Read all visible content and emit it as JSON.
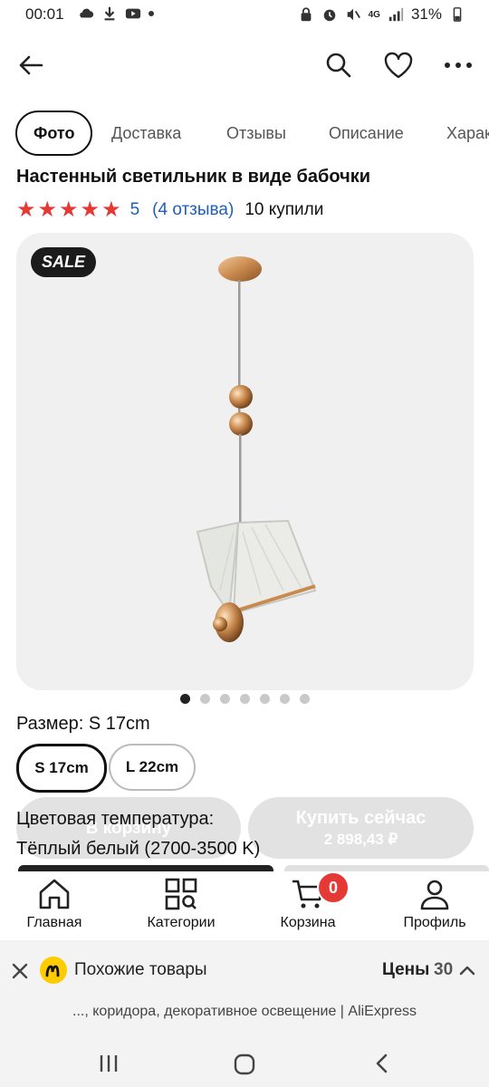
{
  "status": {
    "time": "00:01",
    "battery": "31%",
    "network": "4G"
  },
  "header": {
    "back_icon": "back-arrow-icon",
    "search_icon": "search-icon",
    "favorite_icon": "heart-icon",
    "more_icon": "more-dots-icon"
  },
  "tabs": [
    {
      "label": "Фото"
    },
    {
      "label": "Доставка"
    },
    {
      "label": "Отзывы"
    },
    {
      "label": "Описание"
    },
    {
      "label": "Харак"
    }
  ],
  "product": {
    "title": "Настенный светильник в виде бабочки",
    "rating": 5,
    "rating_text": "5",
    "reviews_text": "(4 отзыва)",
    "bought_text": "10 купили",
    "sale_badge": "SALE",
    "image_index": 1,
    "image_count": 7
  },
  "size": {
    "label": "Размер: S 17cm",
    "options": [
      "S 17cm",
      "L 22cm"
    ],
    "selected": "S 17cm"
  },
  "color_temperature": {
    "label": "Цветовая температура:",
    "value": "Тёплый белый (2700-3500 K)"
  },
  "actions": {
    "cart_label": "В корзину",
    "buy_label": "Купить сейчас",
    "buy_price": "2 898,43 ₽"
  },
  "bottom_nav": [
    {
      "label": "Главная",
      "icon": "home-icon"
    },
    {
      "label": "Категории",
      "icon": "categories-icon"
    },
    {
      "label": "Корзина",
      "icon": "cart-icon",
      "badge": "0"
    },
    {
      "label": "Профиль",
      "icon": "profile-icon"
    }
  ],
  "suggest_bar": {
    "title": "Похожие товары",
    "prices_label": "Цены",
    "prices_count": "30",
    "page_url_text": "..., коридора, декоративное освещение | AliExpress"
  },
  "colors": {
    "star": "#e53935",
    "link": "#1f5fb8",
    "badge": "#e53935",
    "yandex_yellow": "#ffcc00"
  }
}
